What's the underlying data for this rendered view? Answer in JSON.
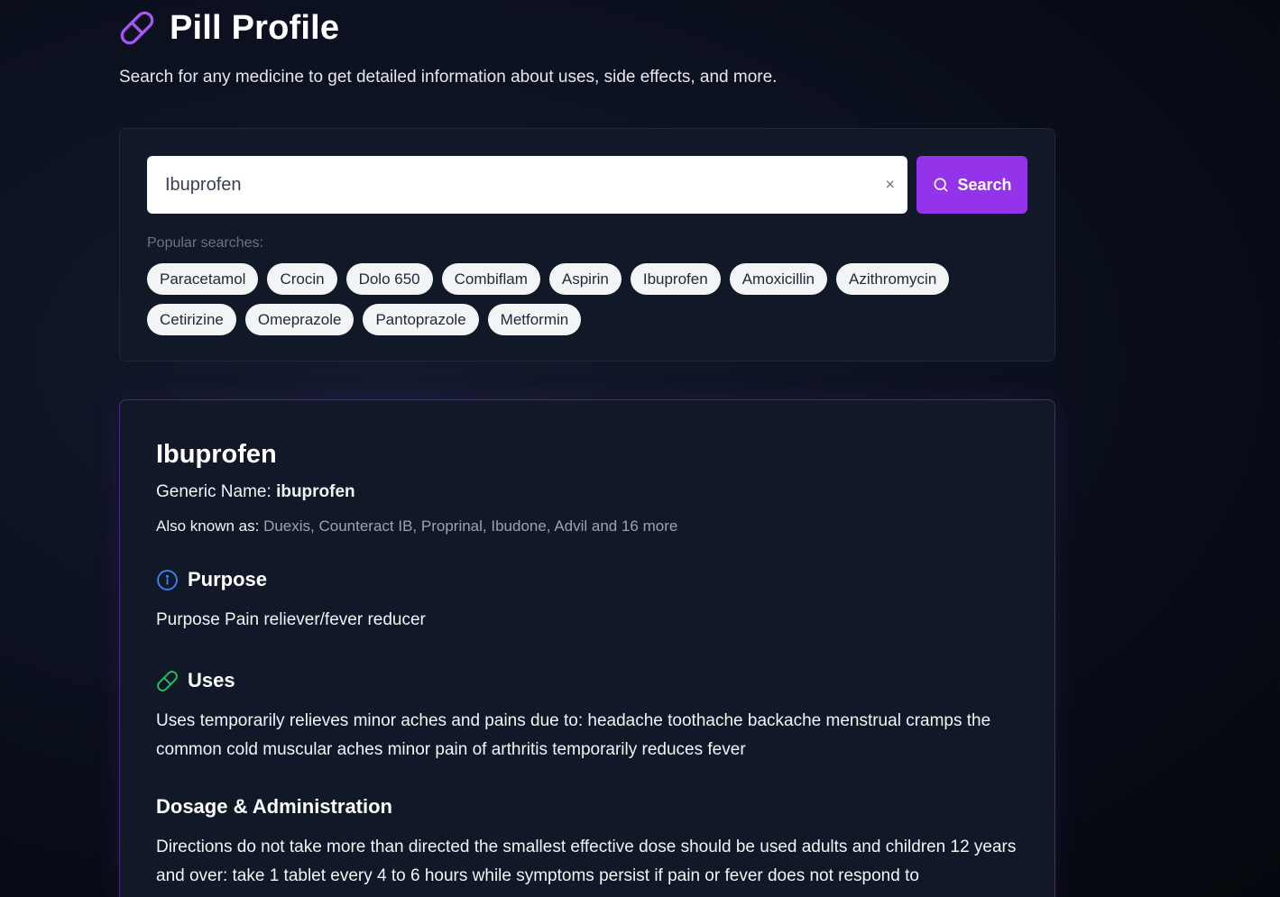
{
  "app": {
    "title": "Pill Profile",
    "subtitle": "Search for any medicine to get detailed information about uses, side effects, and more.",
    "logo_icon": "pill-icon",
    "accent": "#9333ea"
  },
  "search": {
    "value": "Ibuprofen",
    "clear_symbol": "×",
    "button_label": "Search",
    "button_icon": "search-icon",
    "popular_label": "Popular searches:",
    "popular": [
      "Paracetamol",
      "Crocin",
      "Dolo 650",
      "Combiflam",
      "Aspirin",
      "Ibuprofen",
      "Amoxicillin",
      "Azithromycin",
      "Cetirizine",
      "Omeprazole",
      "Pantoprazole",
      "Metformin"
    ]
  },
  "result": {
    "name": "Ibuprofen",
    "generic_label": "Generic Name:",
    "generic_value": "ibuprofen",
    "aka_label": "Also known as:",
    "aka_value": "Duexis, Counteract IB, Proprinal, Ibudone, Advil and 16 more",
    "sections": [
      {
        "title": "Purpose",
        "icon": "info-icon",
        "icon_color": "#3b82f6",
        "body": "Purpose Pain reliever/fever reducer"
      },
      {
        "title": "Uses",
        "icon": "pill-icon",
        "icon_color": "#22c55e",
        "body": "Uses temporarily relieves minor aches and pains due to: headache toothache backache menstrual cramps the common cold muscular aches minor pain of arthritis temporarily reduces fever"
      },
      {
        "title": "Dosage & Administration",
        "body": "Directions do not take more than directed the smallest effective dose should be used adults and children 12 years and over: take 1 tablet every 4 to 6 hours while symptoms persist if pain or fever does not respond to"
      }
    ]
  }
}
